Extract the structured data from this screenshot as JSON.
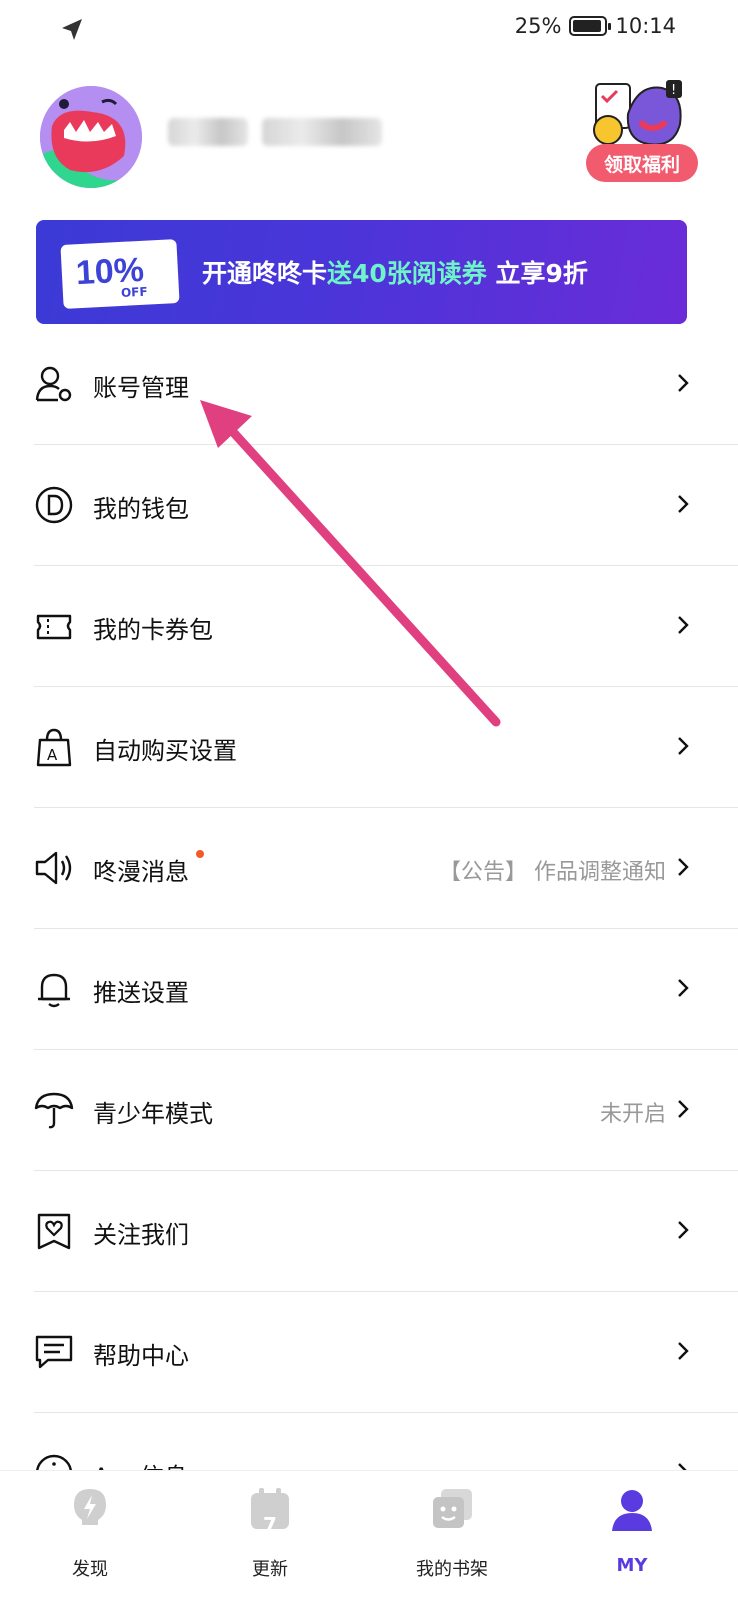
{
  "status_bar": {
    "battery_percent": "25%",
    "time": "10:14"
  },
  "profile": {
    "welfare_button": "领取福利"
  },
  "banner": {
    "text_main": "开通咚咚卡",
    "text_highlight": "送40张阅读券",
    "text_end": " 立享9折",
    "coupon_text": "10%",
    "coupon_off": "OFF"
  },
  "menu": [
    {
      "label": "账号管理",
      "value": "",
      "icon": "user-gear-icon"
    },
    {
      "label": "我的钱包",
      "value": "",
      "icon": "coin-icon"
    },
    {
      "label": "我的卡券包",
      "value": "",
      "icon": "ticket-icon"
    },
    {
      "label": "自动购买设置",
      "value": "",
      "icon": "shopping-bag-icon"
    },
    {
      "label": "咚漫消息",
      "value": "【公告】 作品调整通知",
      "icon": "speaker-icon"
    },
    {
      "label": "推送设置",
      "value": "",
      "icon": "bell-icon"
    },
    {
      "label": "青少年模式",
      "value": "未开启",
      "icon": "umbrella-icon"
    },
    {
      "label": "关注我们",
      "value": "",
      "icon": "heart-bookmark-icon"
    },
    {
      "label": "帮助中心",
      "value": "",
      "icon": "chat-icon"
    },
    {
      "label": "App信息",
      "value": "",
      "icon": "info-icon"
    }
  ],
  "bottom_nav": [
    {
      "label": "发现",
      "icon": "bulb-icon",
      "active": false
    },
    {
      "label": "更新",
      "icon": "calendar-icon",
      "active": false,
      "badge": "7"
    },
    {
      "label": "我的书架",
      "icon": "bookshelf-icon",
      "active": false
    },
    {
      "label": "MY",
      "icon": "profile-icon",
      "active": true
    }
  ],
  "colors": {
    "accent": "#5a3be0",
    "banner_start": "#3b3ad6",
    "banner_end": "#6a2cd8",
    "highlight": "#6ff3c9",
    "arrow": "#e0407f",
    "welfare": "#f25b6e"
  }
}
